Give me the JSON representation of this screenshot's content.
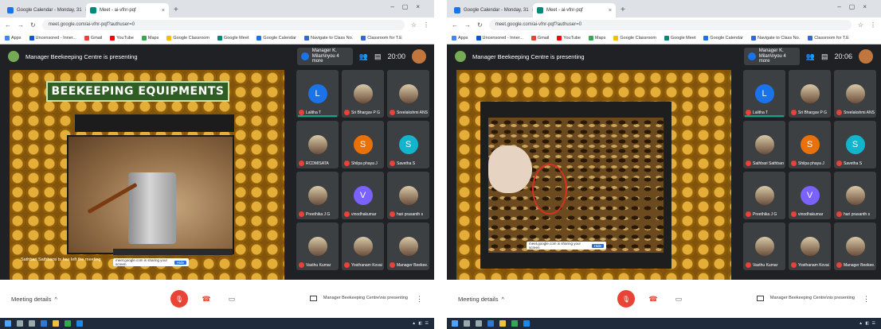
{
  "panels": [
    {
      "tabs": [
        "Google Calendar - Monday, 31",
        "Meet - ai-vfnr-pqf"
      ],
      "url": "meet.google.com/ai-vfnr-pqf?authuser=0",
      "bookmarks": [
        "Apps",
        "Uncensored - Inner...",
        "Gmail",
        "YouTube",
        "Maps",
        "Google Classroom",
        "Google Meet",
        "Google Calendar",
        "Navigate to Class No.",
        "Classroom for T.E"
      ],
      "presenter_text": "Manager Beekeeping Centre is presenting",
      "self_chip": "Manager K. Milan\\nyou 4 more",
      "clock": "20:00",
      "slide_title": "BEEKEEPING EQUIPMENTS",
      "caption": "Sathbari Sathbarsi ts has left the meeting",
      "notice_text": "meet.google.com is sharing your screen",
      "notice_button": "Hide",
      "tiles": [
        {
          "name": "Lalitha T",
          "initial": "L",
          "color": "#1a73e8",
          "photo": false,
          "speaking": true
        },
        {
          "name": "Sri Bhargav P G",
          "initial": "",
          "color": "",
          "photo": true,
          "speaking": false
        },
        {
          "name": "Sreelakshmi ANSET",
          "initial": "",
          "color": "",
          "photo": true,
          "speaking": false
        },
        {
          "name": "RCDMISATA",
          "initial": "",
          "color": "",
          "photo": true,
          "speaking": false
        },
        {
          "name": "Shilpa phaya J",
          "initial": "S",
          "color": "#e8710a",
          "photo": false,
          "speaking": false
        },
        {
          "name": "Savetha S",
          "initial": "S",
          "color": "#12b5cb",
          "photo": false,
          "speaking": false
        },
        {
          "name": "Preethika J G",
          "initial": "",
          "color": "",
          "photo": true,
          "speaking": false
        },
        {
          "name": "vinodhakumar",
          "initial": "V",
          "color": "#7b61ff",
          "photo": false,
          "speaking": false
        },
        {
          "name": "hari prasanth s",
          "initial": "",
          "color": "",
          "photo": true,
          "speaking": false
        },
        {
          "name": "Vasthu Kumar",
          "initial": "",
          "color": "",
          "photo": true,
          "speaking": false
        },
        {
          "name": "Yosthanam Kovai",
          "initial": "",
          "color": "",
          "photo": true,
          "speaking": false
        },
        {
          "name": "Manager Beekee...",
          "initial": "",
          "color": "",
          "photo": true,
          "speaking": false
        }
      ],
      "meeting_details": "Meeting details",
      "presenting_label": "Manager Beekeeping Centre\\nis presenting"
    },
    {
      "tabs": [
        "Google Calendar - Monday, 31",
        "Meet - ai-vfnr-pqf"
      ],
      "url": "meet.google.com/ai-vfnr-pqf?authuser=0",
      "bookmarks": [
        "Apps",
        "Uncensored - Inner...",
        "Gmail",
        "YouTube",
        "Maps",
        "Google Classroom",
        "Google Meet",
        "Google Calendar",
        "Navigate to Class No.",
        "Classroom for T.E"
      ],
      "presenter_text": "Manager Beekeeping Centre is presenting",
      "self_chip": "Manager K. Milan\\nyou 4 more",
      "clock": "20:06",
      "notice_text": "meet.google.com is sharing your screen",
      "notice_button": "Hide",
      "tiles": [
        {
          "name": "Lalitha T",
          "initial": "L",
          "color": "#1a73e8",
          "photo": false,
          "speaking": true
        },
        {
          "name": "Sri Bhargav P G",
          "initial": "",
          "color": "",
          "photo": true,
          "speaking": false
        },
        {
          "name": "Sreelakshmi ANSET",
          "initial": "",
          "color": "",
          "photo": true,
          "speaking": false
        },
        {
          "name": "Sathbari Sathbarsi",
          "initial": "",
          "color": "",
          "photo": true,
          "speaking": false
        },
        {
          "name": "Shilpa phaya J",
          "initial": "S",
          "color": "#e8710a",
          "photo": false,
          "speaking": false
        },
        {
          "name": "Savetha S",
          "initial": "S",
          "color": "#12b5cb",
          "photo": false,
          "speaking": false
        },
        {
          "name": "Preethika J G",
          "initial": "",
          "color": "",
          "photo": true,
          "speaking": false
        },
        {
          "name": "vinodhakumar",
          "initial": "V",
          "color": "#7b61ff",
          "photo": false,
          "speaking": false
        },
        {
          "name": "hari prasanth s",
          "initial": "",
          "color": "",
          "photo": true,
          "speaking": false
        },
        {
          "name": "Vasthu Kumar",
          "initial": "",
          "color": "",
          "photo": true,
          "speaking": false
        },
        {
          "name": "Yosthanam Kovai",
          "initial": "",
          "color": "",
          "photo": true,
          "speaking": false
        },
        {
          "name": "Manager Beekee...",
          "initial": "",
          "color": "",
          "photo": true,
          "speaking": false
        }
      ],
      "meeting_details": "Meeting details",
      "presenting_label": "Manager Beekeeping Centre\\nis presenting"
    }
  ],
  "colors": {
    "meet_bg": "#202124",
    "tile_bg": "#3c4043",
    "end_call": "#ea4335",
    "slide_title_bg": "#2f5e24",
    "queen_marker": "#d93025"
  }
}
